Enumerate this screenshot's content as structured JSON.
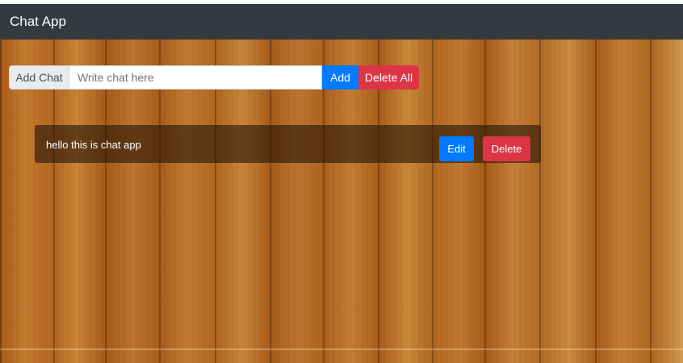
{
  "navbar": {
    "brand": "Chat App"
  },
  "form": {
    "addon_label": "Add Chat",
    "input_value": "",
    "input_placeholder": "Write chat here",
    "add_label": "Add",
    "delete_all_label": "Delete All"
  },
  "chats": [
    {
      "text": "hello this is chat app",
      "edit_label": "Edit",
      "delete_label": "Delete"
    }
  ],
  "colors": {
    "navbar": "#343a40",
    "primary": "#007bff",
    "danger": "#dc3545"
  }
}
